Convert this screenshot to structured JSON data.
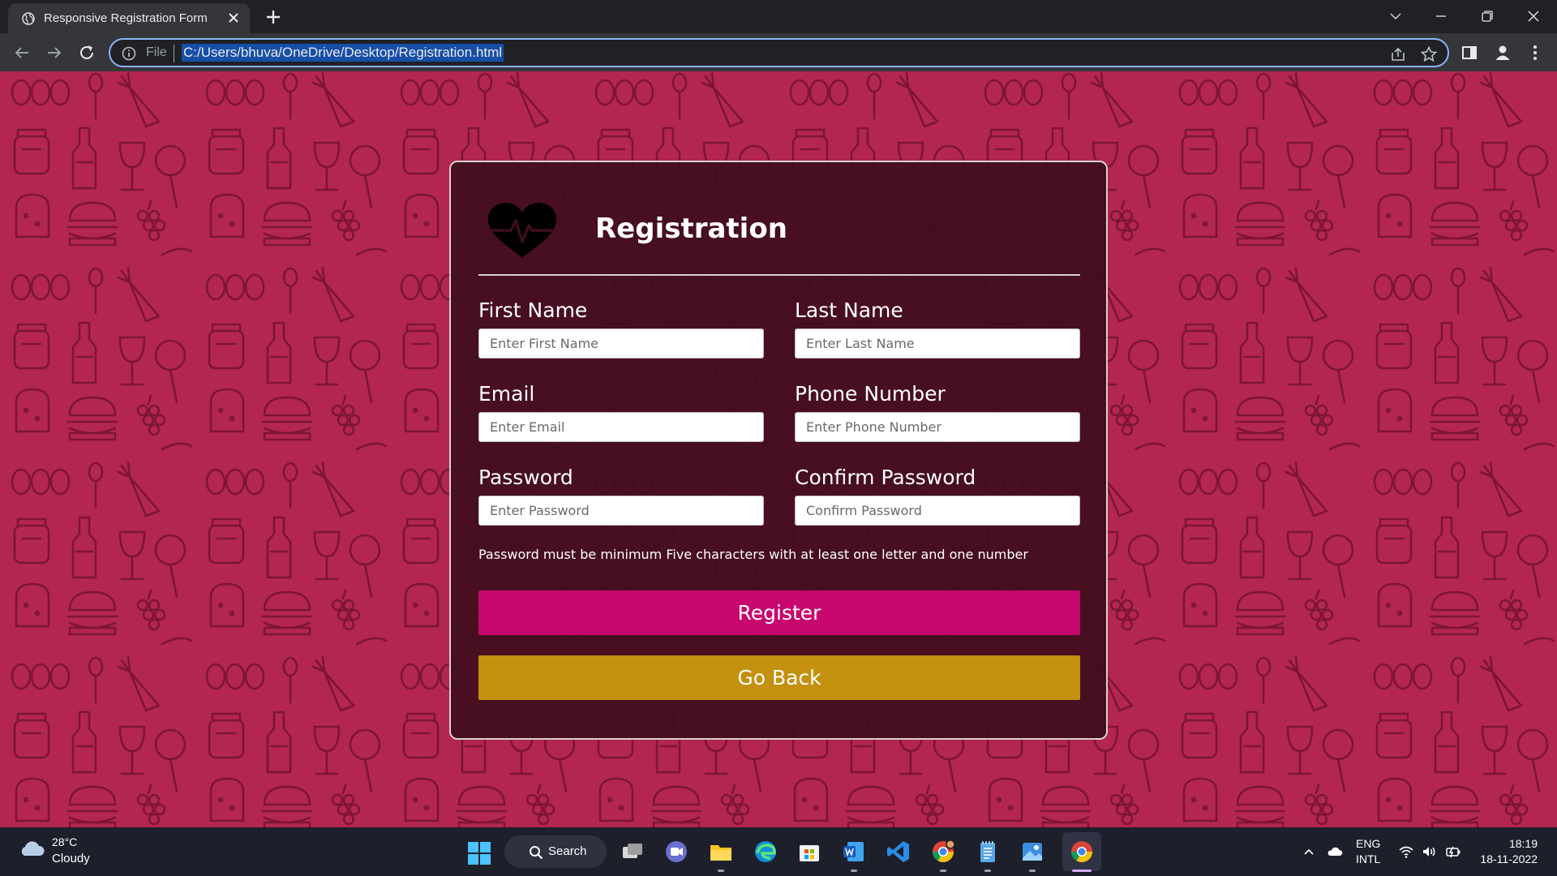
{
  "browser": {
    "tab_title": "Responsive Registration Form",
    "omnibox_scheme": "File",
    "url": "C:/Users/bhuva/OneDrive/Desktop/Registration.html"
  },
  "form": {
    "title": "Registration",
    "fields": [
      {
        "label": "First Name",
        "placeholder": "Enter First Name"
      },
      {
        "label": "Last Name",
        "placeholder": "Enter Last Name"
      },
      {
        "label": "Email",
        "placeholder": "Enter Email"
      },
      {
        "label": "Phone Number",
        "placeholder": "Enter Phone Number"
      },
      {
        "label": "Password",
        "placeholder": "Enter Password"
      },
      {
        "label": "Confirm Password",
        "placeholder": "Confirm Password"
      }
    ],
    "password_hint": "Password must be minimum Five characters with at least one letter and one number",
    "register_label": "Register",
    "goback_label": "Go Back"
  },
  "taskbar": {
    "temperature": "28°C",
    "condition": "Cloudy",
    "search_label": "Search",
    "lang_top": "ENG",
    "lang_bottom": "INTL",
    "time": "18:19",
    "date": "18-11-2022"
  },
  "colors": {
    "page_background": "#b3264f",
    "card_background": "#3e0e1d",
    "register_button": "#c8076e",
    "goback_button": "#c4900f",
    "omnibox_focus": "#8ab4f8"
  }
}
